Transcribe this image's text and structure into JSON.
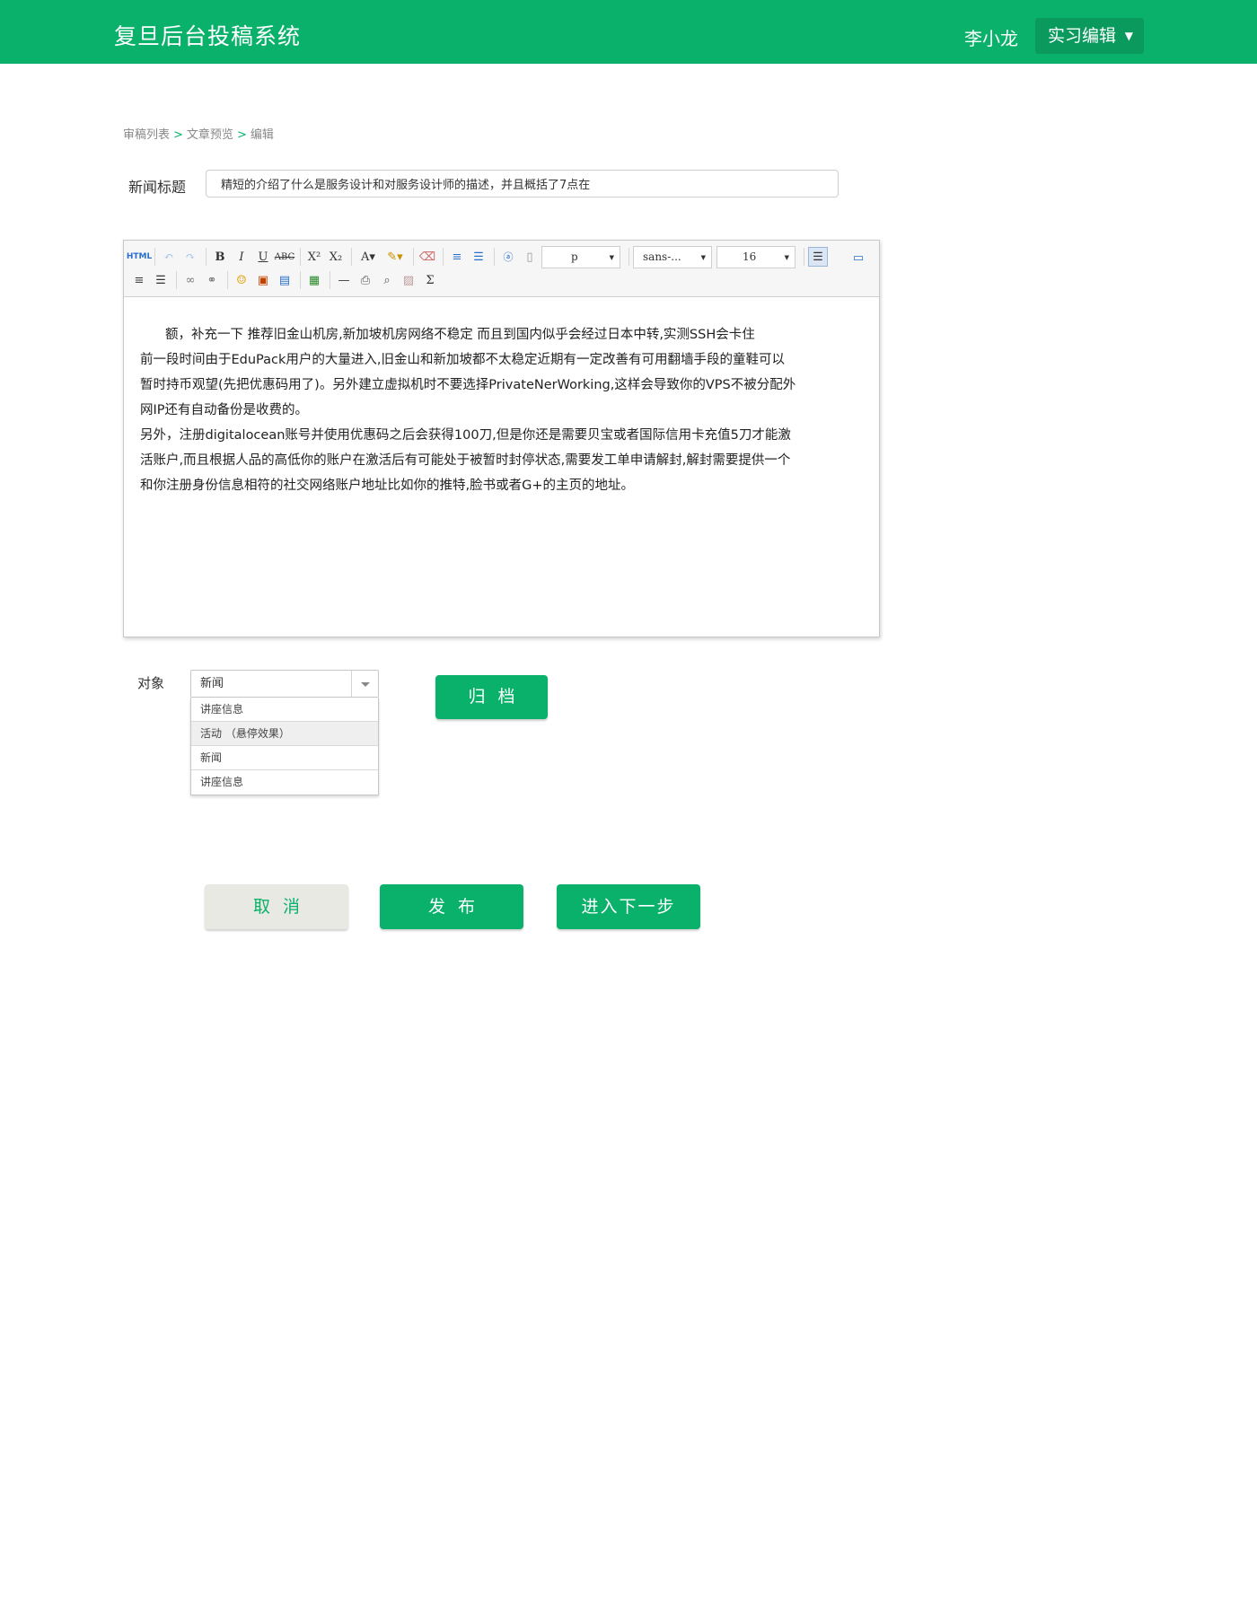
{
  "header": {
    "brand": "复旦后台投稿系统",
    "user_name": "李小龙",
    "role_label": "实习编辑",
    "role_caret": "▼"
  },
  "breadcrumb": {
    "items": [
      "审稿列表",
      "文章预览",
      "编辑"
    ],
    "separator": ">"
  },
  "form": {
    "title_label": "新闻标题",
    "title_value": "精短的介绍了什么是服务设计和对服务设计师的描述，并且概括了7点在"
  },
  "editor": {
    "toolbar": {
      "html_label": "HTML",
      "format_select": "p",
      "font_select": "sans-...",
      "size_select": "16"
    },
    "paragraphs": [
      "额，补充一下 推荐旧金山机房,新加坡机房网络不稳定 而且到国内似乎会经过日本中转,实测SSH会卡住",
      "前一段时间由于EduPack用户的大量进入,旧金山和新加坡都不太稳定近期有一定改善有可用翻墙手段的童鞋可以",
      "暂时持币观望(先把优惠码用了)。另外建立虚拟机时不要选择PrivateNerWorking,这样会导致你的VPS不被分配外",
      "网IP还有自动备份是收费的。",
      "另外，注册digitalocean账号并使用优惠码之后会获得100刀,但是你还是需要贝宝或者国际信用卡充值5刀才能激",
      "活账户,而且根据人品的高低你的账户在激活后有可能处于被暂时封停状态,需要发工单申请解封,解封需要提供一个",
      "和你注册身份信息相符的社交网络账户地址比如你的推特,脸书或者G+的主页的地址。"
    ]
  },
  "target": {
    "label": "对象",
    "selected": "新闻",
    "options": [
      "讲座信息",
      "活动 （悬停效果）",
      "新闻",
      "讲座信息"
    ]
  },
  "actions": {
    "archive": "归档",
    "cancel": "取消",
    "publish": "发布",
    "next": "进入下一步"
  },
  "colors": {
    "brand_green": "#09b16b",
    "header_dark_green": "#0a9a5e",
    "cancel_bg": "#e9e9e4"
  }
}
